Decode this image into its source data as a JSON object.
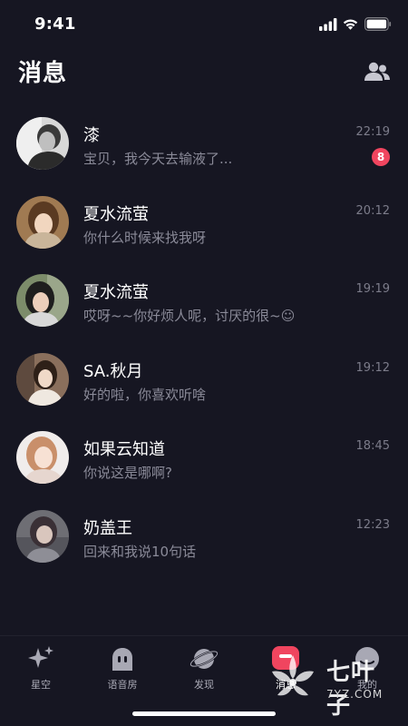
{
  "status_bar": {
    "time": "9:41"
  },
  "header": {
    "title": "消息",
    "contacts_icon": "contacts-icon"
  },
  "conversations": [
    {
      "name": "漆",
      "preview": "宝贝，我今天去输液了...",
      "time": "22:19",
      "unread": "8",
      "avatar": "avatar-0"
    },
    {
      "name": "夏水流萤",
      "preview": "你什么时候来找我呀",
      "time": "20:12",
      "avatar": "avatar-1"
    },
    {
      "name": "夏水流萤",
      "preview": "哎呀~~你好烦人呢，讨厌的很~☺",
      "time": "19:19",
      "avatar": "avatar-2"
    },
    {
      "name": "SA.秋月",
      "preview": "好的啦，你喜欢听啥",
      "time": "19:12",
      "avatar": "avatar-3"
    },
    {
      "name": "如果云知道",
      "preview": "你说这是哪啊?",
      "time": "18:45",
      "avatar": "avatar-4"
    },
    {
      "name": "奶盖王",
      "preview": "回来和我说10句话",
      "time": "12:23",
      "avatar": "avatar-5"
    }
  ],
  "tabs": [
    {
      "label": "星空",
      "icon": "sparkle-icon"
    },
    {
      "label": "语音房",
      "icon": "voice-room-icon"
    },
    {
      "label": "发现",
      "icon": "planet-icon"
    },
    {
      "label": "消息",
      "icon": "message-icon",
      "active": true
    },
    {
      "label": "我的",
      "icon": "profile-icon"
    }
  ],
  "watermark": {
    "title": "七叶子",
    "url": "7YZ.COM"
  },
  "colors": {
    "background": "#161622",
    "badge": "#f0455f",
    "active_tab": "#f0455f",
    "muted_text": "#8a8a98"
  }
}
